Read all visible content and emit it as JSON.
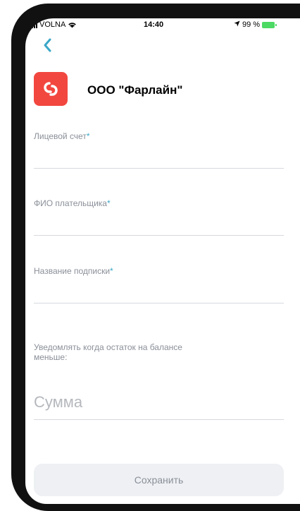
{
  "status_bar": {
    "carrier": "VOLNA",
    "time": "14:40",
    "battery": "99 %"
  },
  "header": {
    "back_icon": "chevron-left-icon",
    "company_name": "ООО \"Фарлайн\"",
    "logo_icon": "link-icon"
  },
  "form": {
    "account_label": "Лицевой счет",
    "payer_label": "ФИО плательщика",
    "subscription_label": "Название подписки",
    "required_mark": "*",
    "notify_label": "Уведомлять когда остаток на балансе меньше:",
    "amount_placeholder": "Сумма",
    "save_label": "Сохранить"
  },
  "colors": {
    "accent": "#3aa7c7",
    "logo": "#f2473f",
    "battery": "#4cd964"
  }
}
